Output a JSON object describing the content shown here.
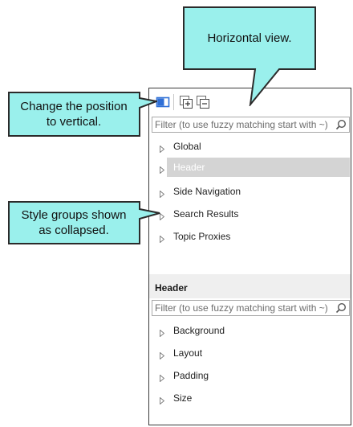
{
  "callouts": {
    "horizontal": "Horizontal view.",
    "vertical_line1": "Change the position",
    "vertical_line2": "to vertical.",
    "collapsed_line1": "Style groups shown",
    "collapsed_line2": "as collapsed."
  },
  "toolbar": {
    "icons": [
      "layout-toggle-icon",
      "expand-all-icon",
      "collapse-all-icon"
    ]
  },
  "top_filter": {
    "placeholder": "Filter (to use fuzzy matching start with ~)"
  },
  "style_groups": [
    {
      "label": "Global",
      "selected": false
    },
    {
      "label": "Header",
      "selected": true
    },
    {
      "label": "Side Navigation",
      "selected": false
    },
    {
      "label": "Search Results",
      "selected": false
    },
    {
      "label": "Topic Proxies",
      "selected": false
    }
  ],
  "properties": {
    "title": "Header",
    "filter_placeholder": "Filter (to use fuzzy matching start with ~)",
    "groups": [
      {
        "label": "Background"
      },
      {
        "label": "Layout"
      },
      {
        "label": "Padding"
      },
      {
        "label": "Size"
      }
    ]
  },
  "colors": {
    "callout_fill": "#9af0ec",
    "callout_border": "#2b2b2b",
    "toggle_icon": "#2f6fd6",
    "selected_row": "#d4d4d4"
  }
}
